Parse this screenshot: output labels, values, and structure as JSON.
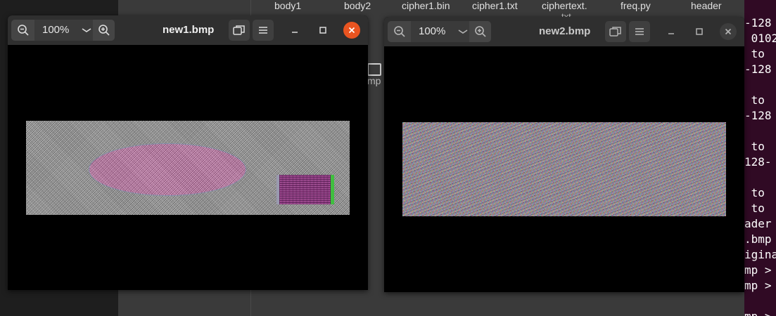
{
  "file_manager": {
    "columns": [
      "body1",
      "body2",
      "cipher1.bin",
      "cipher1.txt",
      "ciphertext.",
      "freq.py",
      "header"
    ],
    "ciphertext_sub": "txt",
    "desktop_file_label": "mp"
  },
  "terminal": {
    "lines": [
      "-128",
      " 0102",
      " to ",
      "-128",
      "",
      " to ",
      "-128",
      "",
      " to ",
      "128-",
      "",
      " to ",
      " to ",
      "ader",
      ".bmp",
      "igina",
      "mp >",
      "mp >",
      "",
      "mp >"
    ]
  },
  "windows": [
    {
      "title": "new1.bmp",
      "zoom": "100%",
      "active": true,
      "image": "new1.bmp"
    },
    {
      "title": "new2.bmp",
      "zoom": "100%",
      "active": false,
      "image": "new2.bmp"
    }
  ],
  "colors": {
    "close_active": "#e95420",
    "titlebar": "#2f2f2f",
    "terminal_bg": "#300a24"
  }
}
